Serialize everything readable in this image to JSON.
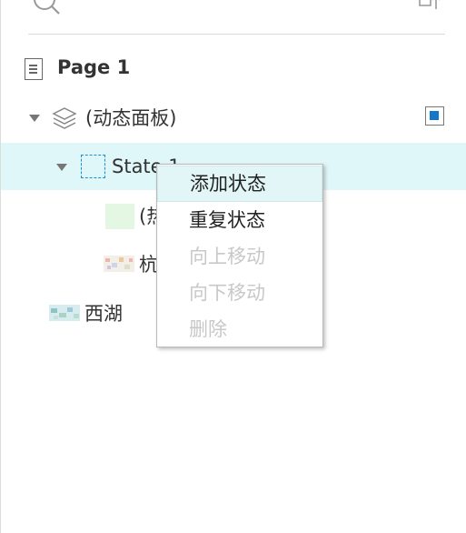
{
  "colors": {
    "selected_row_bg": "#e0f7f9",
    "menu_hover_bg": "#e2f6f8",
    "accent_blue": "#1c8fd0",
    "disabled_text": "#c8c8c8"
  },
  "toolbar": {
    "search_icon": "search-icon",
    "sort_icon": "sort-icon"
  },
  "tree": {
    "page": {
      "label": "Page 1",
      "icon": "page-icon"
    },
    "dynamic_panel": {
      "label": "(动态面板)",
      "icon": "layers-icon",
      "expanded": true,
      "pin_icon": "pin-checkbox-icon"
    },
    "state": {
      "label": "State 1",
      "icon": "dashed-box-icon",
      "expanded": true,
      "selected": true
    },
    "children": [
      {
        "label": "(热",
        "icon": "hotspot-icon"
      },
      {
        "label": "杭",
        "icon": "image-thumbnail-icon"
      }
    ],
    "west_lake": {
      "label": "西湖",
      "icon": "image-thumbnail-icon"
    }
  },
  "context_menu": {
    "items": [
      {
        "label": "添加状态",
        "enabled": true,
        "hovered": true
      },
      {
        "label": "重复状态",
        "enabled": true,
        "hovered": false
      },
      {
        "label": "向上移动",
        "enabled": false,
        "hovered": false
      },
      {
        "label": "向下移动",
        "enabled": false,
        "hovered": false
      },
      {
        "label": "删除",
        "enabled": false,
        "hovered": false
      }
    ]
  }
}
